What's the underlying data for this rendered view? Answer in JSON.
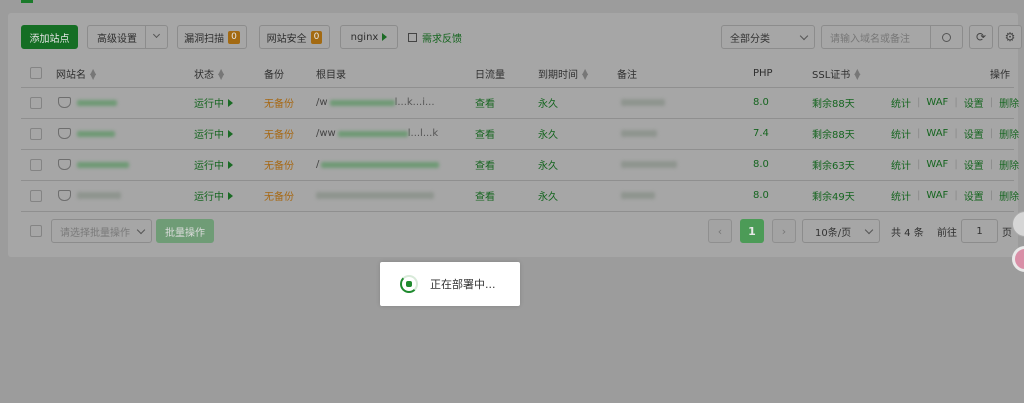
{
  "toolbar": {
    "add_site": "添加站点",
    "advanced": "高级设置",
    "vuln_scan": "漏洞扫描",
    "vuln_count": "0",
    "site_security": "网站安全",
    "security_count": "0",
    "nginx": "nginx",
    "feedback": "需求反馈",
    "category": "全部分类",
    "search_placeholder": "请输入域名或备注"
  },
  "table": {
    "headers": {
      "name": "网站名",
      "status": "状态",
      "backup": "备份",
      "root": "根目录",
      "traffic": "日流量",
      "expire": "到期时间",
      "note": "备注",
      "php": "PHP",
      "ssl": "SSL证书",
      "actions": "操作"
    },
    "rows": [
      {
        "status": "运行中",
        "backup": "无备份",
        "root_prefix": "/w",
        "root_suffix": "l...k...i...",
        "traffic": "查看",
        "expire": "永久",
        "php": "8.0",
        "ssl": "剩余88天"
      },
      {
        "status": "运行中",
        "backup": "无备份",
        "root_prefix": "/ww",
        "root_suffix": "l...l...k",
        "traffic": "查看",
        "expire": "永久",
        "php": "7.4",
        "ssl": "剩余88天"
      },
      {
        "status": "运行中",
        "backup": "无备份",
        "root_prefix": "/",
        "root_suffix": "",
        "traffic": "查看",
        "expire": "永久",
        "php": "8.0",
        "ssl": "剩余63天"
      },
      {
        "status": "运行中",
        "backup": "无备份",
        "root_prefix": "",
        "root_suffix": "",
        "traffic": "查看",
        "expire": "永久",
        "php": "8.0",
        "ssl": "剩余49天"
      }
    ],
    "actions": {
      "stats": "统计",
      "waf": "WAF",
      "settings": "设置",
      "delete": "删除"
    }
  },
  "footer": {
    "batch_placeholder": "请选择批量操作",
    "batch_button": "批量操作",
    "current_page": "1",
    "page_size": "10条/页",
    "total": "共 4 条",
    "goto_label": "前往",
    "goto_value": "1",
    "page_suffix": "页"
  },
  "loading": {
    "text": "正在部署中..."
  }
}
